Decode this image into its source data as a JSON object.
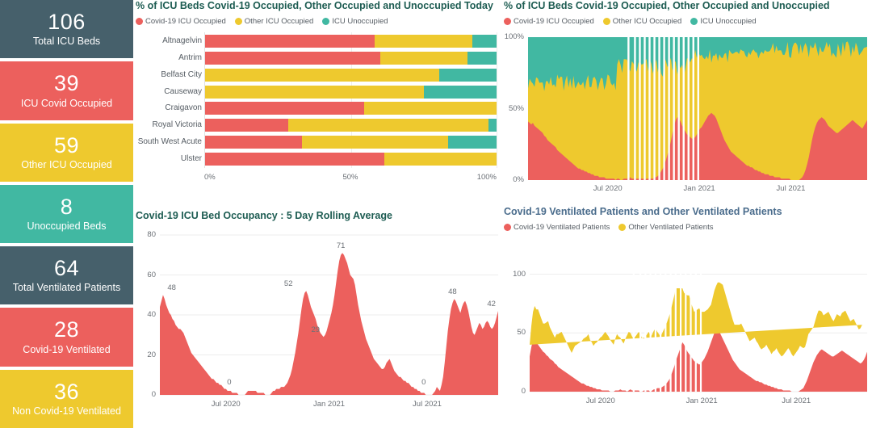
{
  "kpi_tiles": [
    {
      "value": "106",
      "label": "Total ICU Beds",
      "color": "#46606b"
    },
    {
      "value": "39",
      "label": "ICU Covid Occupied",
      "color": "#ec605d"
    },
    {
      "value": "59",
      "label": "Other ICU Occupied",
      "color": "#eec92e"
    },
    {
      "value": "8",
      "label": "Unoccupied Beds",
      "color": "#41b8a2"
    },
    {
      "value": "64",
      "label": "Total Ventilated Patients",
      "color": "#46606b"
    },
    {
      "value": "28",
      "label": "Covid-19 Ventilated",
      "color": "#ec605d"
    },
    {
      "value": "36",
      "label": "Non Covid-19 Ventilated",
      "color": "#eec92e"
    }
  ],
  "colors": {
    "covid": "#ec605d",
    "other": "#eec92e",
    "unoccupied": "#41b8a2",
    "slate": "#46606b",
    "title_green": "#1d5c52",
    "title_blue": "#4a6c8c",
    "axis_text": "#6b7076",
    "grid": "#ededed"
  },
  "panel_top_left": {
    "title": "% of ICU Beds Covid-19 Occupied, Other Occupied and Unoccupied Today",
    "legend": [
      {
        "label": "Covid-19 ICU Occupied",
        "color": "#ec605d"
      },
      {
        "label": "Other ICU Occupied",
        "color": "#eec92e"
      },
      {
        "label": "ICU Unoccupied",
        "color": "#41b8a2"
      }
    ],
    "chart_data": {
      "type": "bar",
      "orientation": "horizontal",
      "stacked": true,
      "title": "% of ICU Beds Covid-19 Occupied, Other Occupied and Unoccupied Today",
      "xlabel": "",
      "ylabel": "",
      "xlim": [
        0,
        100
      ],
      "xticks": [
        "0%",
        "50%",
        "100%"
      ],
      "grid": true,
      "legend_position": "top",
      "categories": [
        "Altnagelvin",
        "Antrim",
        "Belfast City",
        "Causeway",
        "Craigavon",
        "Royal Victoria",
        "South West Acute",
        "Ulster"
      ],
      "series": [
        {
          "name": "Covid-19 ICU Occupied",
          "color": "#ec605d",
          "values": [
            58.3,
            60.2,
            0,
            0,
            54.5,
            28.6,
            33.3,
            61.5
          ]
        },
        {
          "name": "Other ICU Occupied",
          "color": "#eec92e",
          "values": [
            33.3,
            29.8,
            80.3,
            75.2,
            45.5,
            68.6,
            50.0,
            38.5
          ]
        },
        {
          "name": "ICU Unoccupied",
          "color": "#41b8a2",
          "values": [
            8.4,
            10.0,
            19.7,
            24.8,
            0,
            2.8,
            16.7,
            0
          ]
        }
      ]
    }
  },
  "panel_top_right": {
    "title": "% of ICU Beds Covid-19 Occupied, Other Occupied and Unoccupied",
    "legend": [
      {
        "label": "Covid-19 ICU Occupied",
        "color": "#ec605d"
      },
      {
        "label": "Other ICU Occupied",
        "color": "#eec92e"
      },
      {
        "label": "ICU Unoccupied",
        "color": "#41b8a2"
      }
    ],
    "chart_data": {
      "type": "area",
      "stacked": true,
      "percent": true,
      "title": "% of ICU Beds Covid-19 Occupied, Other Occupied and Unoccupied",
      "xlabel": "",
      "ylabel": "",
      "ylim": [
        0,
        100
      ],
      "yticks": [
        "0%",
        "50%",
        "100%"
      ],
      "xticks": [
        "Jul 2020",
        "Jan 2021",
        "Jul 2021"
      ],
      "xtick_positions_pct": [
        23.5,
        50.5,
        77.5
      ],
      "grid": false,
      "legend_position": "top",
      "series": [
        {
          "name": "Covid-19 ICU Occupied",
          "color": "#ec605d",
          "values": [
            41,
            40,
            39,
            40,
            38,
            37,
            36,
            35,
            34,
            33,
            31,
            30,
            28,
            27,
            26,
            25,
            24,
            23,
            21,
            20,
            19,
            18,
            17,
            16,
            15,
            14,
            13,
            12,
            11,
            10,
            9,
            8,
            8,
            7,
            7,
            6,
            6,
            5,
            5,
            4,
            4,
            3,
            3,
            3,
            2,
            2,
            2,
            2,
            1,
            1,
            1,
            1,
            1,
            1,
            0,
            1,
            1,
            0,
            0,
            1,
            1,
            1,
            1,
            2,
            1,
            1,
            1,
            1,
            1,
            1,
            1,
            1,
            0,
            1,
            1,
            1,
            1,
            1,
            2,
            2,
            3,
            4,
            6,
            8,
            11,
            14,
            18,
            22,
            27,
            33,
            38,
            42,
            44,
            43,
            41,
            38,
            36,
            34,
            32,
            31,
            30,
            29,
            29,
            30,
            32,
            34,
            36,
            37,
            39,
            41,
            43,
            45,
            46,
            47,
            46,
            45,
            43,
            40,
            37,
            34,
            31,
            28,
            26,
            24,
            22,
            20,
            19,
            18,
            17,
            16,
            15,
            14,
            13,
            12,
            11,
            10,
            10,
            9,
            9,
            8,
            7,
            7,
            6,
            6,
            5,
            5,
            4,
            4,
            4,
            3,
            3,
            3,
            2,
            2,
            2,
            2,
            1,
            1,
            1,
            1,
            1,
            1,
            0,
            0,
            0,
            0,
            0,
            0,
            1,
            2,
            4,
            7,
            11,
            16,
            22,
            28,
            33,
            37,
            40,
            42,
            43,
            44,
            43,
            42,
            40,
            38,
            37,
            36,
            35,
            34,
            33,
            33,
            34,
            35,
            36,
            37,
            38,
            39,
            40,
            41,
            42,
            41,
            40,
            39,
            38,
            37,
            36,
            38,
            40,
            42
          ]
        }
      ],
      "notes": "Stacked to 100%: Other ICU Occupied fills mid band, ICU Unoccupied fills remainder to 100%. Gaps (missing data) shown as white vertical stripes mid-2020."
    }
  },
  "panel_bottom_left": {
    "title": "Covid-19 ICU Bed Occupancy : 5 Day Rolling Average",
    "chart_data": {
      "type": "area",
      "title": "Covid-19 ICU Bed Occupancy : 5 Day Rolling Average",
      "xlabel": "",
      "ylabel": "",
      "ylim": [
        0,
        80
      ],
      "yticks": [
        "0",
        "20",
        "40",
        "60",
        "80"
      ],
      "xticks": [
        "Jul 2020",
        "Jan 2021",
        "Jul 2021"
      ],
      "xtick_positions_pct": [
        19.5,
        50.0,
        79.0
      ],
      "grid": true,
      "color": "#ec605d",
      "data_labels": [
        {
          "value": "48",
          "x_pct": 3.5,
          "y_value": 50
        },
        {
          "value": "0",
          "x_pct": 20.5,
          "y_value": 3
        },
        {
          "value": "52",
          "x_pct": 38.0,
          "y_value": 52
        },
        {
          "value": "29",
          "x_pct": 46.0,
          "y_value": 29
        },
        {
          "value": "71",
          "x_pct": 53.5,
          "y_value": 71
        },
        {
          "value": "0",
          "x_pct": 78.0,
          "y_value": 3
        },
        {
          "value": "48",
          "x_pct": 86.5,
          "y_value": 48
        },
        {
          "value": "42",
          "x_pct": 98.0,
          "y_value": 42
        }
      ],
      "values": [
        44,
        47,
        50,
        48,
        45,
        43,
        41,
        40,
        38,
        37,
        35,
        34,
        33,
        33,
        32,
        31,
        29,
        27,
        25,
        23,
        21,
        20,
        19,
        18,
        17,
        16,
        15,
        14,
        13,
        12,
        11,
        10,
        9,
        8,
        8,
        7,
        6,
        6,
        5,
        5,
        4,
        3,
        3,
        2,
        2,
        2,
        1,
        1,
        1,
        1,
        0,
        0,
        0,
        0,
        0,
        1,
        2,
        2,
        2,
        2,
        2,
        2,
        1,
        1,
        1,
        1,
        1,
        0,
        0,
        0,
        0,
        1,
        2,
        2,
        3,
        3,
        3,
        4,
        4,
        4,
        5,
        6,
        8,
        10,
        13,
        17,
        21,
        26,
        31,
        37,
        43,
        48,
        51,
        52,
        50,
        47,
        44,
        42,
        40,
        38,
        35,
        33,
        31,
        30,
        29,
        30,
        32,
        35,
        38,
        41,
        45,
        50,
        56,
        62,
        67,
        70,
        71,
        70,
        68,
        66,
        63,
        60,
        59,
        58,
        55,
        50,
        45,
        41,
        37,
        34,
        31,
        28,
        26,
        24,
        22,
        20,
        18,
        17,
        16,
        15,
        14,
        13,
        13,
        14,
        16,
        17,
        18,
        16,
        14,
        12,
        11,
        10,
        9,
        9,
        8,
        7,
        7,
        6,
        6,
        5,
        4,
        4,
        3,
        3,
        2,
        2,
        1,
        1,
        1,
        0,
        0,
        0,
        0,
        0,
        1,
        2,
        4,
        3,
        2,
        5,
        9,
        16,
        24,
        32,
        38,
        43,
        46,
        48,
        47,
        45,
        43,
        41,
        44,
        46,
        47,
        45,
        42,
        38,
        34,
        31,
        30,
        32,
        34,
        36,
        35,
        33,
        34,
        36,
        37,
        36,
        34,
        33,
        34,
        36,
        39,
        42
      ]
    }
  },
  "panel_bottom_right": {
    "title": "Covid-19 Ventilated Patients and Other Ventilated Patients",
    "legend": [
      {
        "label": "Covid-19 Ventilated Patients",
        "color": "#ec605d"
      },
      {
        "label": "Other Ventilated Patients",
        "color": "#eec92e"
      }
    ],
    "chart_data": {
      "type": "area",
      "stacked": true,
      "title": "Covid-19 Ventilated Patients and Other Ventilated Patients",
      "xlabel": "",
      "ylabel": "",
      "ylim": [
        0,
        110
      ],
      "yticks": [
        "0",
        "50",
        "100"
      ],
      "xticks": [
        "Jul 2020",
        "Jan 2021",
        "Jul 2021"
      ],
      "xtick_positions_pct": [
        21.0,
        51.0,
        79.0
      ],
      "grid": true,
      "legend_position": "top",
      "series": [
        {
          "name": "Covid-19 Ventilated Patients",
          "color": "#ec605d",
          "values": [
            30,
            38,
            44,
            46,
            42,
            40,
            38,
            36,
            34,
            33,
            31,
            30,
            28,
            27,
            26,
            24,
            23,
            21,
            20,
            19,
            18,
            17,
            16,
            15,
            14,
            13,
            12,
            11,
            10,
            9,
            8,
            7,
            7,
            6,
            5,
            5,
            4,
            4,
            3,
            3,
            2,
            2,
            2,
            1,
            1,
            1,
            1,
            1,
            0,
            0,
            0,
            1,
            1,
            1,
            2,
            1,
            1,
            1,
            0,
            1,
            2,
            1,
            1,
            1,
            1,
            1,
            0,
            0,
            1,
            1,
            1,
            1,
            0,
            1,
            2,
            2,
            3,
            3,
            3,
            4,
            5,
            6,
            8,
            10,
            13,
            17,
            21,
            26,
            30,
            34,
            38,
            42,
            40,
            37,
            34,
            32,
            30,
            28,
            26,
            25,
            24,
            23,
            24,
            26,
            28,
            31,
            34,
            38,
            42,
            46,
            50,
            52,
            53,
            51,
            48,
            45,
            42,
            39,
            36,
            33,
            30,
            27,
            25,
            23,
            21,
            19,
            18,
            17,
            16,
            15,
            14,
            13,
            12,
            11,
            10,
            9,
            9,
            8,
            8,
            7,
            6,
            6,
            5,
            5,
            4,
            4,
            3,
            3,
            2,
            2,
            2,
            1,
            1,
            1,
            1,
            1,
            0,
            0,
            0,
            0,
            0,
            1,
            2,
            3,
            6,
            9,
            13,
            17,
            21,
            25,
            28,
            31,
            33,
            35,
            36,
            35,
            34,
            33,
            32,
            31,
            30,
            30,
            31,
            32,
            33,
            34,
            35,
            34,
            33,
            32,
            31,
            30,
            29,
            28,
            27,
            26,
            25,
            24,
            25,
            27,
            30,
            34
          ]
        },
        {
          "name": "Other Ventilated Patients",
          "color": "#eec92e",
          "values": [
            10,
            18,
            24,
            27,
            28,
            30,
            28,
            26,
            24,
            25,
            28,
            30,
            27,
            25,
            23,
            22,
            26,
            28,
            30,
            32,
            30,
            28,
            26,
            24,
            22,
            20,
            24,
            28,
            30,
            32,
            34,
            36,
            38,
            40,
            42,
            44,
            40,
            38,
            36,
            38,
            40,
            42,
            44,
            46,
            48,
            50,
            48,
            46,
            44,
            42,
            40,
            44,
            48,
            46,
            44,
            42,
            40,
            44,
            48,
            50,
            48,
            46,
            44,
            46,
            48,
            50,
            48,
            46,
            44,
            46,
            48,
            50,
            46,
            48,
            50,
            52,
            48,
            46,
            44,
            46,
            48,
            50,
            52,
            54,
            56,
            58,
            60,
            62,
            58,
            54,
            50,
            46,
            44,
            46,
            48,
            50,
            46,
            44,
            42,
            44,
            46,
            48,
            44,
            42,
            40,
            38,
            36,
            34,
            32,
            34,
            36,
            38,
            40,
            42,
            44,
            46,
            44,
            42,
            40,
            38,
            36,
            34,
            32,
            34,
            36,
            38,
            40,
            38,
            36,
            34,
            32,
            30,
            32,
            34,
            36,
            34,
            32,
            30,
            28,
            30,
            32,
            34,
            32,
            30,
            28,
            30,
            32,
            34,
            32,
            30,
            28,
            30,
            32,
            34,
            36,
            34,
            32,
            30,
            32,
            34,
            36,
            38,
            36,
            34,
            32,
            34,
            36,
            34,
            32,
            30,
            32,
            34,
            36,
            34,
            32,
            30,
            32,
            34,
            36,
            34,
            32,
            30,
            32,
            34,
            32,
            30,
            32,
            34,
            36,
            34,
            32,
            30,
            32,
            34,
            32,
            30,
            28,
            30,
            32,
            30
          ]
        }
      ]
    }
  }
}
